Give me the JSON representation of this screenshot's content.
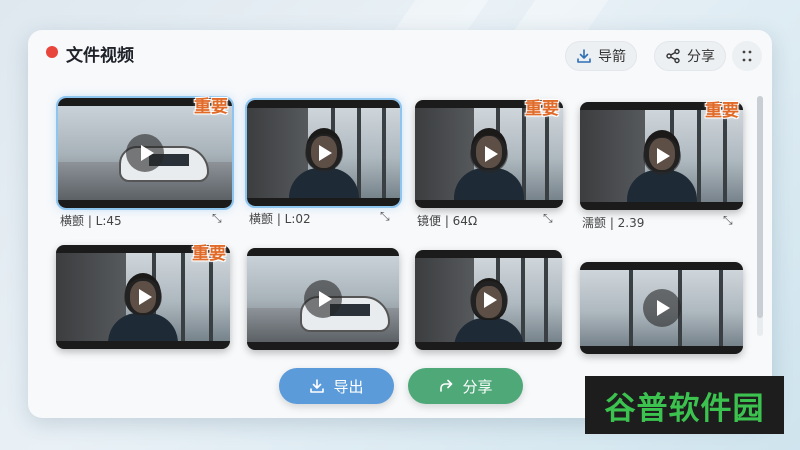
{
  "panel": {
    "title": "文件视频",
    "toolbar": {
      "export_label": "导箭",
      "share_label": "分享"
    }
  },
  "badge_text": "重要",
  "videos": [
    {
      "caption": "横颤 | L:45",
      "important": true,
      "selected": true,
      "scene": "train"
    },
    {
      "caption": "横颤 | L:02",
      "important": false,
      "selected": true,
      "scene": "office"
    },
    {
      "caption": "镜便 | 64Ω",
      "important": true,
      "selected": false,
      "scene": "office"
    },
    {
      "caption": "濡颤 | 2.39",
      "important": true,
      "selected": false,
      "scene": "office"
    },
    {
      "caption": "",
      "important": true,
      "selected": false,
      "scene": "office"
    },
    {
      "caption": "",
      "important": false,
      "selected": false,
      "scene": "train"
    },
    {
      "caption": "",
      "important": false,
      "selected": false,
      "scene": "office"
    },
    {
      "caption": "",
      "important": false,
      "selected": false,
      "scene": "window"
    }
  ],
  "footer": {
    "export_label": "导出",
    "share_label": "分享"
  },
  "watermark": "谷普软件园",
  "colors": {
    "accent_blue": "#5b9bd9",
    "accent_green": "#4fa878",
    "badge_orange": "#e06a28",
    "status_dot": "#e8453c"
  }
}
